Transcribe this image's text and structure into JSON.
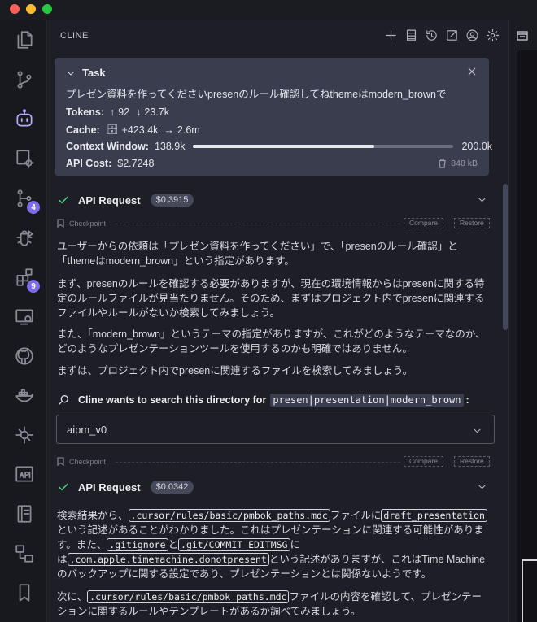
{
  "panel": {
    "title": "CLINE"
  },
  "header_icons": [
    "plus-icon",
    "server-icon",
    "history-icon",
    "external-link-icon",
    "account-icon",
    "settings-icon"
  ],
  "activity_bar": [
    {
      "name": "explorer-icon",
      "badge": null
    },
    {
      "name": "source-control-icon",
      "badge": null
    },
    {
      "name": "cline-icon",
      "badge": null
    },
    {
      "name": "remote-settings-icon",
      "badge": null
    },
    {
      "name": "git-graph-icon",
      "badge": "4"
    },
    {
      "name": "debug-icon",
      "badge": null
    },
    {
      "name": "extensions-icon",
      "badge": "9"
    },
    {
      "name": "remote-explorer-icon",
      "badge": null
    },
    {
      "name": "github-icon",
      "badge": null
    },
    {
      "name": "docker-icon",
      "badge": null
    },
    {
      "name": "ai-icon",
      "badge": null
    },
    {
      "name": "api-icon",
      "badge": null
    },
    {
      "name": "notebook-icon",
      "badge": null
    },
    {
      "name": "diagram-icon",
      "badge": null
    },
    {
      "name": "bookmark-icon",
      "badge": null
    }
  ],
  "task": {
    "label": "Task",
    "text": "プレゼン資料を作ってくださいpresenのルール確認してねthemeはmodern_brownで",
    "tokens_label": "Tokens:",
    "tokens_in": "92",
    "tokens_out": "23.7k",
    "cache_label": "Cache:",
    "cache_write": "+423.4k",
    "cache_read": "2.6m",
    "context_label": "Context Window:",
    "context_used": "138.9k",
    "context_max": "200.0k",
    "context_fraction": 0.694,
    "cost_label": "API Cost:",
    "cost": "$2.7248",
    "size": "848 kB"
  },
  "checkpoint": {
    "label": "Checkpoint",
    "compare": "Compare",
    "restore": "Restore"
  },
  "api_requests": [
    {
      "label": "API Request",
      "cost": "$0.3915"
    },
    {
      "label": "API Request",
      "cost": "$0.0342"
    }
  ],
  "messages": {
    "p1": "ユーザーからの依頼は「プレゼン資料を作ってください」で、「presenのルール確認」と「themeはmodern_brown」という指定があります。",
    "p2": "まず、presenのルールを確認する必要がありますが、現在の環境情報からはpresenに関する特定のルールファイルが見当たりません。そのため、まずはプロジェクト内でpresenに関連するファイルやルールがないか検索してみましょう。",
    "p3": "また、「modern_brown」というテーマの指定がありますが、これがどのようなテーマなのか、どのようなプレゼンテーションツールを使用するのかも明確ではありません。",
    "p4": "まずは、プロジェクト内でpresenに関連するファイルを検索してみましょう。",
    "search_prefix": "Cline wants to search this directory for",
    "search_pattern": "presen|presentation|modern_brown",
    "search_suffix": ":",
    "directory": "aipm_v0",
    "r1_t1": "検索結果から、",
    "r1_c1": ".cursor/rules/basic/pmbok_paths.mdc",
    "r1_t2": "ファイルに",
    "r1_c2": "draft_presentation",
    "r1_t3": "という記述があることがわかりました。これはプレゼンテーションに関連する可能性があります。また、",
    "r1_c3": ".gitignore",
    "r1_t4": "と",
    "r1_c4": ".git/COMMIT_EDITMSG",
    "r1_t5": "には",
    "r1_c5": ".com.apple.timemachine.donotpresent",
    "r1_t6": "という記述がありますが、これはTime Machineのバックアップに関する設定であり、プレゼンテーションとは関係ないようです。",
    "r2_t1": "次に、",
    "r2_c1": ".cursor/rules/basic/pmbok_paths.mdc",
    "r2_t2": "ファイルの内容を確認して、プレゼンテーションに関するルールやテンプレートがあるか調べてみましょう。"
  }
}
